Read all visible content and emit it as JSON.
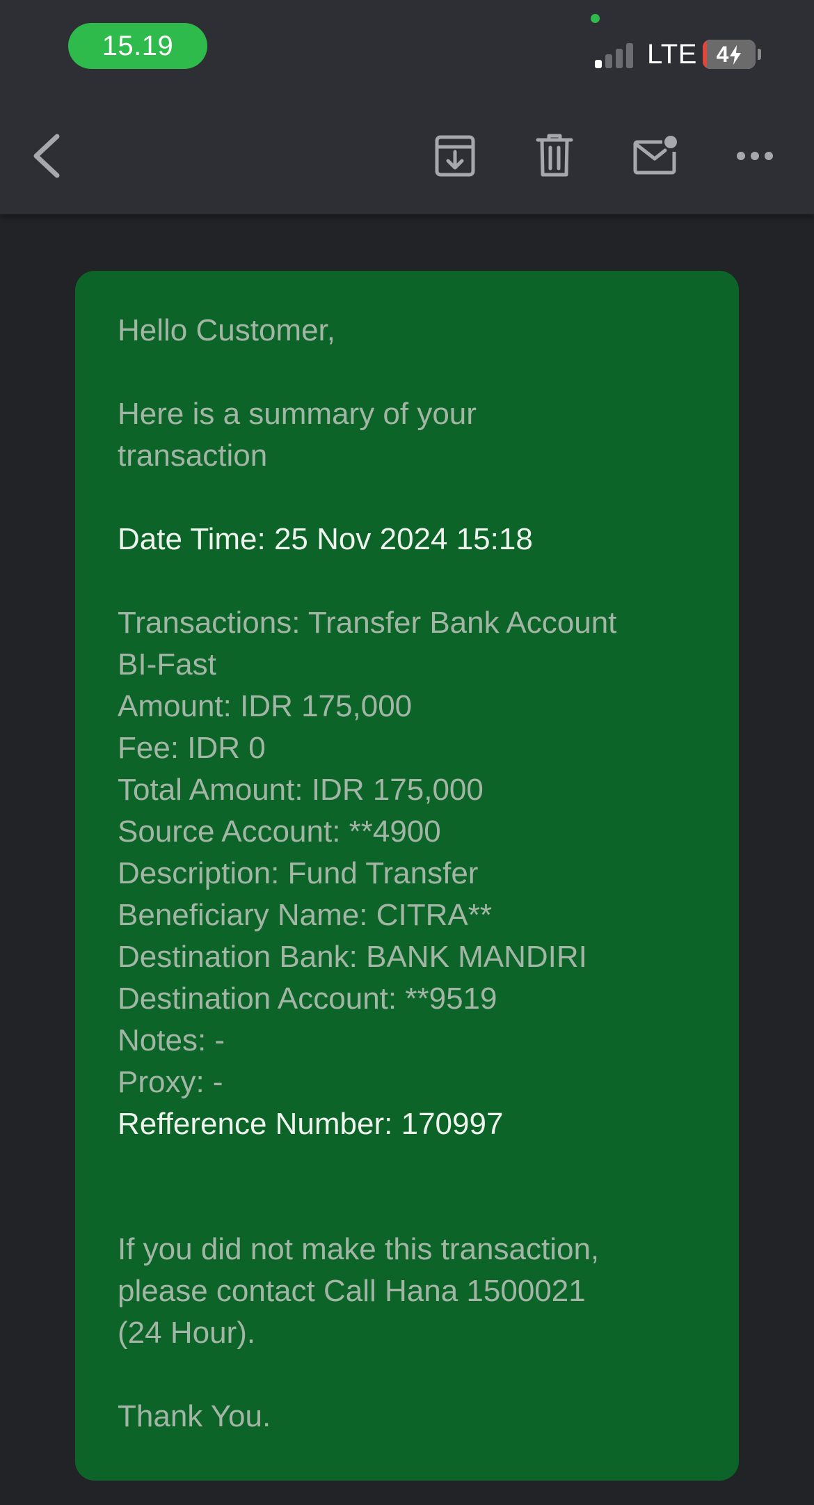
{
  "status_bar": {
    "time": "15.19",
    "network": "LTE",
    "battery_level": "4",
    "battery_fill_fraction": 0.04,
    "signal_bars_active": 1,
    "signal_bars_total": 4
  },
  "toolbar": {
    "back_icon": "chevron-left",
    "archive_icon": "archive-download",
    "trash_icon": "trash",
    "unread_icon": "envelope-with-dot",
    "more_icon": "ellipsis-horizontal"
  },
  "email": {
    "greeting": "Hello Customer,",
    "intro_line1": "Here is a summary of your",
    "intro_line2": "transaction",
    "date_time": "Date Time: 25 Nov 2024 15:18",
    "transactions_line1": "Transactions: Transfer Bank Account",
    "transactions_line2": "BI-Fast",
    "amount": "Amount: IDR 175,000",
    "fee": "Fee: IDR 0",
    "total_amount": "Total Amount: IDR 175,000",
    "source_account": "Source Account: **4900",
    "description": "Description: Fund Transfer",
    "beneficiary_name": "Beneficiary Name: CITRA**",
    "destination_bank": "Destination Bank: BANK MANDIRI",
    "destination_account": "Destination Account: **9519",
    "notes": "Notes: -",
    "proxy": "Proxy: -",
    "reference_number": "Refference Number: 170997",
    "contact_line1": "If you did not make this transaction,",
    "contact_line2": "please contact Call Hana 1500021",
    "contact_line3": "(24 Hour).",
    "closing": "Thank You."
  },
  "colors": {
    "app_background": "#222327",
    "toolbar_background": "#2e2f34",
    "time_pill": "#2fba4c",
    "card_background": "#0c6428",
    "card_text_muted": "#a3b6a6",
    "card_text_bright": "#eef3ee",
    "icon_color": "#a7a8ad"
  }
}
